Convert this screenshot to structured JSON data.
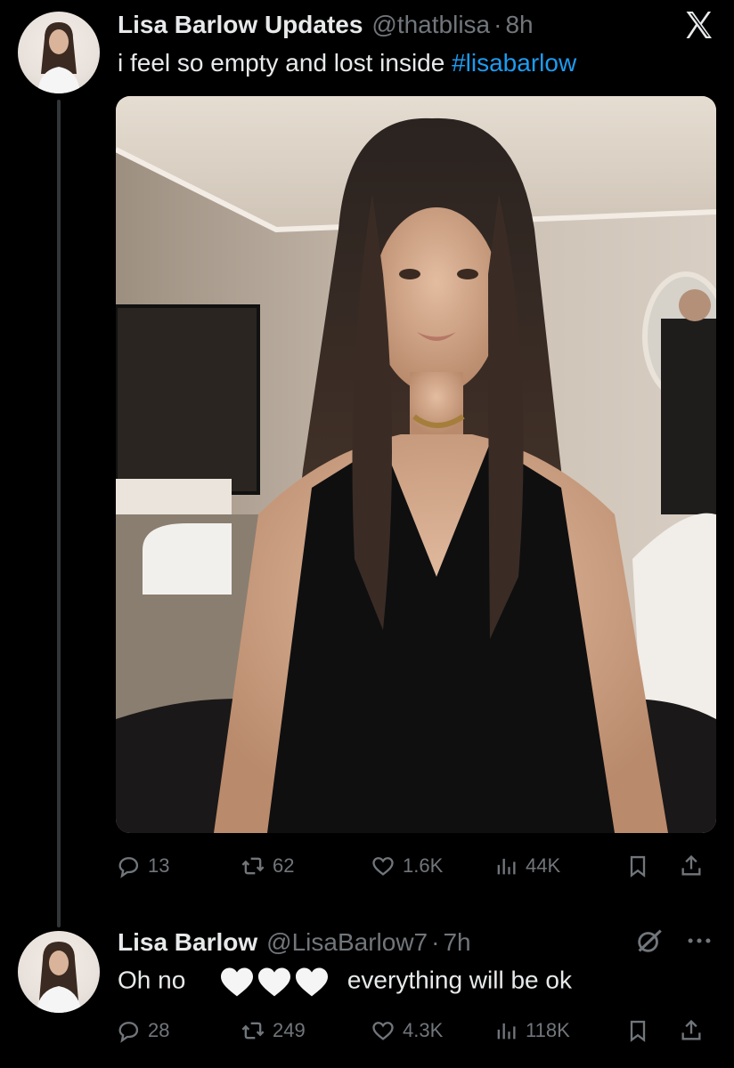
{
  "app": {
    "logo_icon": "x-logo-icon"
  },
  "tweet": {
    "author_name": "Lisa Barlow Updates",
    "handle": "@thatblisa",
    "separator": "·",
    "time": "8h",
    "text": "i feel so empty and lost inside ",
    "hashtag": "#lisabarlow",
    "photo_icon": "photo-woman-long-hair",
    "stats": {
      "replies": "13",
      "reposts": "62",
      "likes": "1.6K",
      "views": "44K"
    }
  },
  "reply": {
    "author_name": "Lisa Barlow",
    "handle": "@LisaBarlow7",
    "separator": "·",
    "time": "7h",
    "text_before": "Oh no",
    "emoji": "white-heart-emoji x3",
    "text_after": "everything will be ok",
    "stats": {
      "replies": "28",
      "reposts": "249",
      "likes": "4.3K",
      "views": "118K"
    }
  },
  "colors": {
    "background": "#000000",
    "text": "#e7e9ea",
    "muted": "#71767b",
    "accent": "#1d9bf0"
  }
}
